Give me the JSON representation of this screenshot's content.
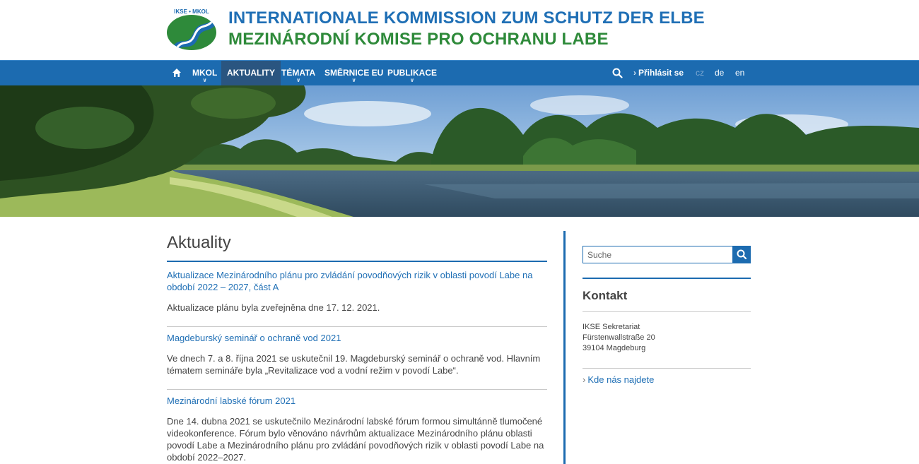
{
  "header": {
    "title_de": "INTERNATIONALE KOMMISSION ZUM SCHUTZ DER ELBE",
    "title_cz": "MEZINÁRODNÍ KOMISE PRO OCHRANU LABE",
    "logo_text": "IKSE • MKOL"
  },
  "nav": {
    "items": [
      {
        "label": "MKOL"
      },
      {
        "label": "AKTUALITY"
      },
      {
        "label": "TÉMATA"
      },
      {
        "label": "SMĚRNICE EU"
      },
      {
        "label": "PUBLIKACE"
      }
    ],
    "login_label": "Přihlásit se",
    "languages": [
      "cz",
      "de",
      "en"
    ],
    "colors": {
      "bar": "#1c6bb0",
      "active": "#2a5580"
    }
  },
  "main": {
    "title": "Aktuality",
    "news": [
      {
        "title": "Aktualizace Mezinárodního plánu pro zvládání povodňových rizik v oblasti povodí Labe na období 2022 – 2027, část A",
        "text": "Aktualizace plánu byla zveřejněna dne 17. 12. 2021."
      },
      {
        "title": "Magdeburský seminář o ochraně vod 2021",
        "text": "Ve dnech 7. a 8. října 2021 se uskutečnil 19. Magdeburský seminář o ochraně vod. Hlavním tématem semináře byla „Revitalizace vod a vodní režim v povodí Labe“."
      },
      {
        "title": "Mezinárodní labské fórum 2021",
        "text": "Dne 14. dubna 2021 se uskutečnilo Mezinárodní labské fórum formou simultánně tlumočené videokonference. Fórum bylo věnováno návrhům aktualizace Mezinárodního plánu oblasti povodí Labe a Mezinárodního plánu pro zvládání povodňových rizik v oblasti povodí Labe na období 2022–2027."
      }
    ]
  },
  "sidebar": {
    "search_placeholder": "Suche",
    "contact_title": "Kontakt",
    "address": [
      "IKSE Sekretariat",
      "Fürstenwallstraße 20",
      "39104 Magdeburg"
    ],
    "find_us_label": "Kde nás najdete"
  }
}
